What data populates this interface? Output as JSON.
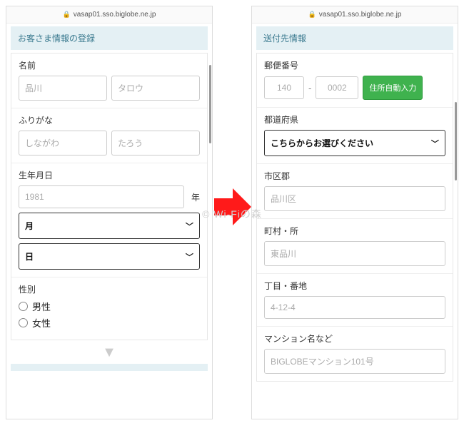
{
  "url": "vasap01.sso.biglobe.ne.jp",
  "watermark": "© Wi-Fiの森",
  "left": {
    "heading": "お客さま情報の登録",
    "name_label": "名前",
    "name_sei_ph": "品川",
    "name_mei_ph": "タロウ",
    "kana_label": "ふりがな",
    "kana_sei_ph": "しながわ",
    "kana_mei_ph": "たろう",
    "dob_label": "生年月日",
    "dob_year_ph": "1981",
    "dob_year_suffix": "年",
    "dob_month": "月",
    "dob_day": "日",
    "gender_label": "性別",
    "gender_male": "男性",
    "gender_female": "女性"
  },
  "right": {
    "heading": "送付先情報",
    "zip_label": "郵便番号",
    "zip1_ph": "140",
    "zip2_ph": "0002",
    "zip_dash": "-",
    "zip_btn": "住所自動入力",
    "pref_label": "都道府県",
    "pref_select_ph": "こちらからお選びください",
    "city_label": "市区郡",
    "city_ph": "品川区",
    "town_label": "町村・所",
    "town_ph": "東品川",
    "block_label": "丁目・番地",
    "block_ph": "4-12-4",
    "bldg_label": "マンション名など",
    "bldg_ph": "BIGLOBEマンション101号"
  }
}
